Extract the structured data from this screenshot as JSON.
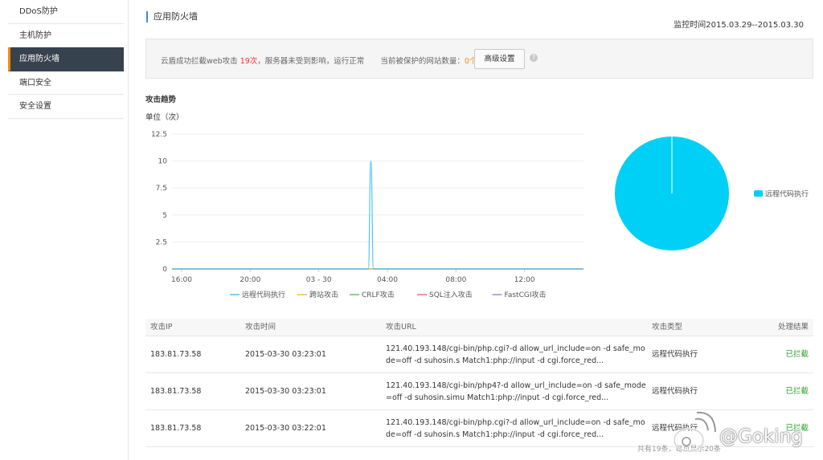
{
  "sidebar": {
    "items": [
      {
        "label": "DDoS防护",
        "active": false
      },
      {
        "label": "主机防护",
        "active": false
      },
      {
        "label": "应用防火墙",
        "active": true
      },
      {
        "label": "端口安全",
        "active": false
      },
      {
        "label": "安全设置",
        "active": false
      }
    ]
  },
  "header": {
    "title": "应用防火墙",
    "monitor_time": "监控时间2015.03.29--2015.03.30"
  },
  "notice": {
    "prefix": "云盾成功拦截web攻击",
    "count": "19次",
    "middle": "，服务器未受到影响，运行正常",
    "protected_label": "当前被保护的网站数量：",
    "protected_count": "0个",
    "advanced_button": "高级设置",
    "help_icon": "question-icon"
  },
  "trend": {
    "title": "攻击趋势",
    "unit": "单位（次）"
  },
  "chart_data": [
    {
      "type": "line",
      "title": "",
      "xlabel": "",
      "ylabel": "",
      "ylim": [
        0,
        12.5
      ],
      "yticks": [
        0,
        2.5,
        5,
        7.5,
        10,
        12.5
      ],
      "xticks": [
        "16:00",
        "20:00",
        "03 - 30",
        "04:00",
        "08:00",
        "12:00"
      ],
      "grid": true,
      "legend_position": "bottom",
      "x_hours": [
        0,
        11.2,
        11.45,
        11.6,
        11.75,
        12.0,
        24
      ],
      "series": [
        {
          "name": "远程代码执行",
          "color": "#4fc3f7",
          "values": [
            0,
            0,
            0,
            10,
            0,
            0,
            0
          ]
        },
        {
          "name": "跨站攻击",
          "color": "#f7c145",
          "values": [
            0,
            0,
            0,
            0,
            0,
            0,
            0
          ]
        },
        {
          "name": "CRLF攻击",
          "color": "#5cc95c",
          "values": [
            0,
            0,
            0,
            0,
            0,
            0,
            0
          ]
        },
        {
          "name": "SQL注入攻击",
          "color": "#f26b6b",
          "values": [
            0,
            0,
            0,
            0,
            0,
            0,
            0
          ]
        },
        {
          "name": "FastCGI攻击",
          "color": "#9a8fe0",
          "values": [
            0,
            0,
            0,
            0,
            0,
            0,
            0
          ]
        }
      ]
    },
    {
      "type": "pie",
      "legend_position": "right",
      "slices": [
        {
          "name": "远程代码执行",
          "value": 19,
          "color": "#00d0f5"
        }
      ]
    }
  ],
  "table": {
    "headers": [
      "攻击IP",
      "攻击时间",
      "攻击URL",
      "攻击类型",
      "处理结果"
    ],
    "rows": [
      {
        "ip": "183.81.73.58",
        "time": "2015-03-30 03:23:01",
        "url": "121.40.193.148/cgi-bin/php.cgi?-d allow_url_include=on -d safe_mode=off -d suhosin.s Match1:php://input -d cgi.force_red...",
        "type": "远程代码执行",
        "result": "已拦截"
      },
      {
        "ip": "183.81.73.58",
        "time": "2015-03-30 03:23:01",
        "url": "121.40.193.148/cgi-bin/php4?-d allow_url_include=on -d safe_mode=off -d suhosin.simu Match1:php://input -d cgi.force_red...",
        "type": "远程代码执行",
        "result": "已拦截"
      },
      {
        "ip": "183.81.73.58",
        "time": "2015-03-30 03:22:01",
        "url": "121.40.193.148/cgi-bin/php.cgi?-d allow_url_include=on -d safe_mode=off -d suhosin.s Match1:php://input -d cgi.force_red...",
        "type": "远程代码执行",
        "result": "已拦截"
      }
    ]
  },
  "footer": {
    "summary": "共有19条，每页显示20条"
  },
  "watermark": {
    "text": "@Goking"
  }
}
